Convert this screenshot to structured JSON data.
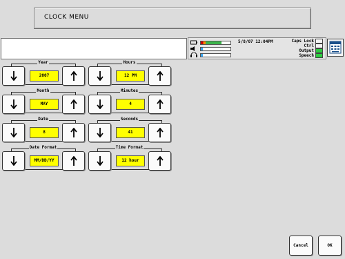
{
  "window": {
    "title": "CLOCK MENU"
  },
  "status": {
    "datetime": "5/8/07 12:04PM",
    "indicators": [
      {
        "label": "Caps Lock",
        "on": false
      },
      {
        "label": "Ctrl",
        "on": false
      },
      {
        "label": "Output",
        "on": true
      },
      {
        "label": "Speech",
        "on": true
      }
    ],
    "meters": [
      {
        "icon": "battery-icon",
        "level": 0.7,
        "color": "#3cb44b"
      },
      {
        "icon": "speaker-icon",
        "level": 0.0,
        "color": "#3fa9f5"
      },
      {
        "icon": "headphones-icon",
        "level": 0.0,
        "color": "#3fa9f5"
      }
    ]
  },
  "fields": {
    "year": {
      "label": "Year",
      "value": "2007"
    },
    "month": {
      "label": "Month",
      "value": "MAY"
    },
    "date": {
      "label": "Date",
      "value": "8"
    },
    "date_format": {
      "label": "Date Format",
      "value": "MM/DD/YY"
    },
    "hours": {
      "label": "Hours",
      "value": "12 PM"
    },
    "minutes": {
      "label": "Minutes",
      "value": "4"
    },
    "seconds": {
      "label": "Seconds",
      "value": "41"
    },
    "time_format": {
      "label": "Time Format",
      "value": "12 hour"
    }
  },
  "buttons": {
    "cancel": "Cancel",
    "ok": "OK"
  }
}
